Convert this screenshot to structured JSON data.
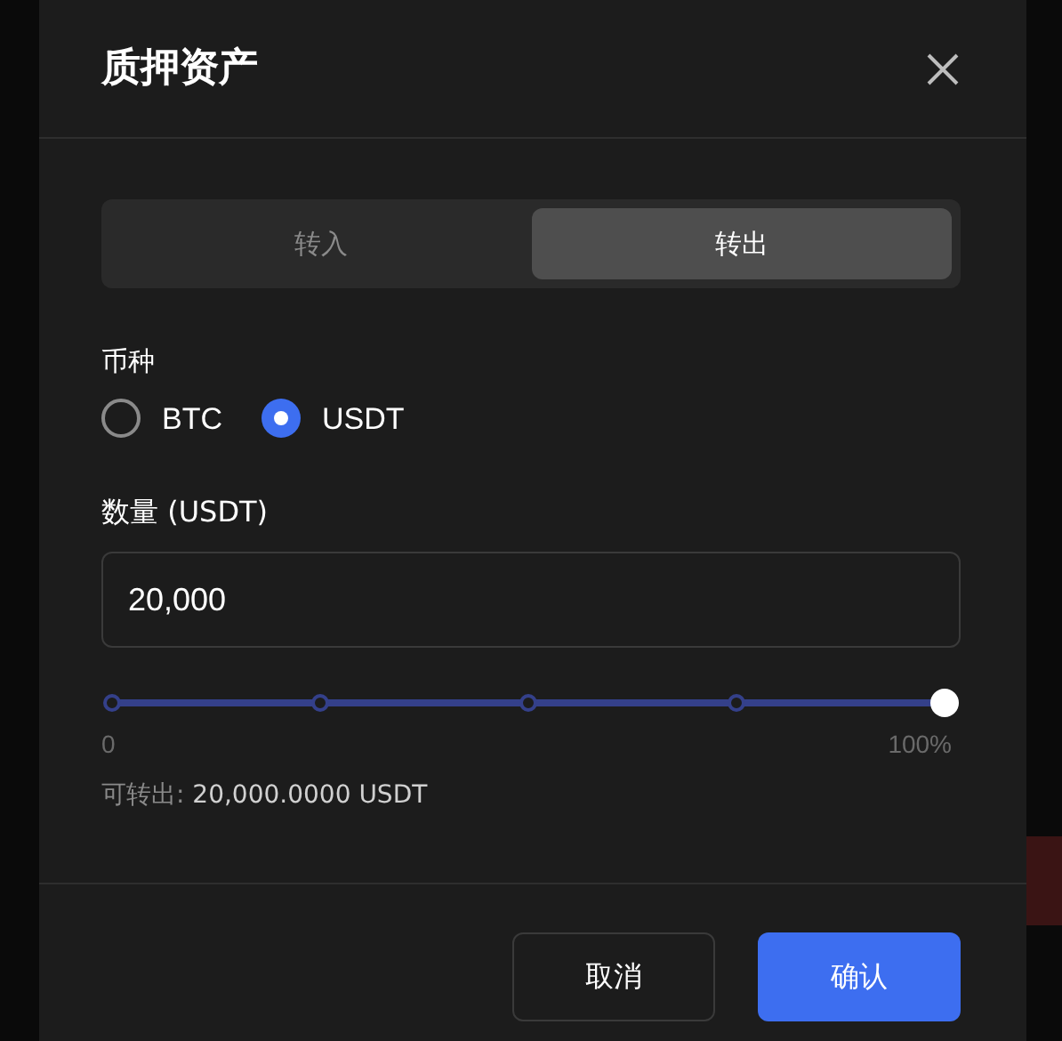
{
  "dialog": {
    "title": "质押资产"
  },
  "tabs": [
    {
      "label": "转入",
      "selected": false
    },
    {
      "label": "转出",
      "selected": true
    }
  ],
  "currency": {
    "label": "币种",
    "options": [
      {
        "label": "BTC",
        "selected": false
      },
      {
        "label": "USDT",
        "selected": true
      }
    ]
  },
  "amount": {
    "label": "数量 (USDT)",
    "value": "20,000"
  },
  "slider": {
    "level": 1,
    "min_label": "0",
    "max_label": "100%"
  },
  "available": {
    "label": "可转出:",
    "value": "20,000.0000 USDT"
  },
  "buttons": [
    {
      "label": "取消",
      "kind": "secondary"
    },
    {
      "label": "确认",
      "kind": "primary"
    }
  ]
}
